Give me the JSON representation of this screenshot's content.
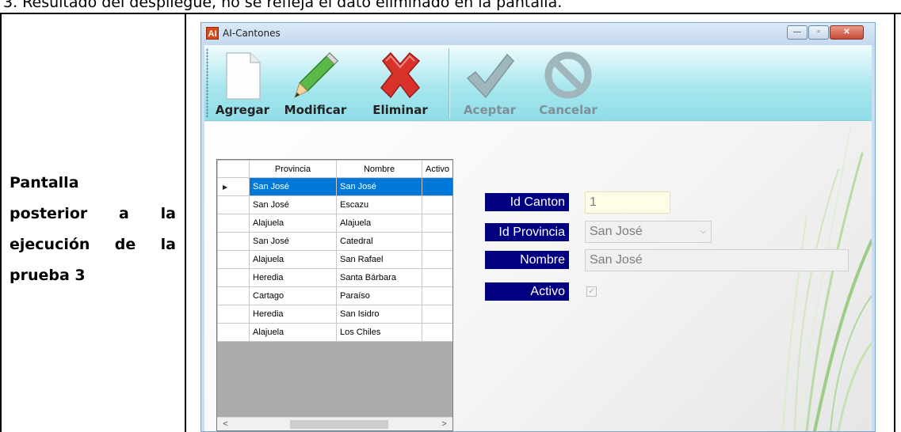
{
  "document": {
    "header_text": "3. Resultado del despliegue, no se refleja el dato eliminado en la pantalla.",
    "side_label_lines": [
      "Pantalla",
      "posterior a la",
      "ejecución de la",
      "prueba 3"
    ]
  },
  "window": {
    "icon_text": "AI",
    "title": "AI-Cantones",
    "controls": {
      "minimize": "—",
      "maximize": "▫",
      "close": "✕"
    }
  },
  "toolbar": {
    "buttons": [
      {
        "label": "Agregar",
        "icon": "new-document-icon",
        "enabled": true
      },
      {
        "label": "Modificar",
        "icon": "pencil-icon",
        "enabled": true
      },
      {
        "label": "Eliminar",
        "icon": "delete-x-icon",
        "enabled": true
      },
      {
        "label": "Aceptar",
        "icon": "checkmark-icon",
        "enabled": false
      },
      {
        "label": "Cancelar",
        "icon": "cancel-circle-icon",
        "enabled": false
      }
    ]
  },
  "grid": {
    "columns": [
      "Provincia",
      "Nombre",
      "Activo"
    ],
    "rows": [
      [
        "San José",
        "San José",
        ""
      ],
      [
        "San José",
        "Escazu",
        ""
      ],
      [
        "Alajuela",
        "Alajuela",
        ""
      ],
      [
        "San José",
        "Catedral",
        ""
      ],
      [
        "Alajuela",
        "San Rafael",
        ""
      ],
      [
        "Heredia",
        "Santa Bárbara",
        ""
      ],
      [
        "Cartago",
        "Paraíso",
        ""
      ],
      [
        "Heredia",
        "San Isidro",
        ""
      ],
      [
        "Alajuela",
        "Los Chiles",
        ""
      ]
    ],
    "selected_row": 0,
    "row_indicator": "▶",
    "scroll_left": "<",
    "scroll_right": ">"
  },
  "form": {
    "id_canton_label": "Id Canton",
    "id_canton_value": "1",
    "id_provincia_label": "Id Provincia",
    "id_provincia_value": "San José",
    "nombre_label": "Nombre",
    "nombre_value": "San José",
    "activo_label": "Activo",
    "activo_checked": true,
    "check_mark": "✓",
    "dropdown_mark": "⌵"
  },
  "colors": {
    "label_bg": "#000080",
    "selection": "#0078d7",
    "toolbar": "#a9e7ee"
  }
}
